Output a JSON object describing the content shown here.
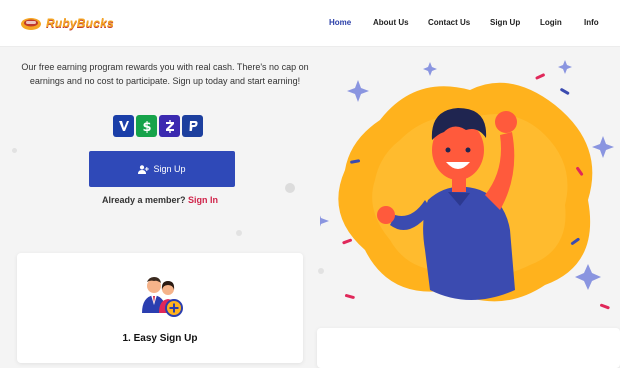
{
  "brand": {
    "name": "RubyBucks"
  },
  "nav": {
    "items": [
      {
        "label": "Home",
        "active": true
      },
      {
        "label": "About Us"
      },
      {
        "label": "Contact Us"
      },
      {
        "label": "Sign Up"
      },
      {
        "label": "Login"
      },
      {
        "label": "Info"
      }
    ]
  },
  "hero": {
    "description": "Our free earning program rewards you with real cash. There's no cap on earnings and no cost to participate. Sign up today and start earning!",
    "payment_icons": [
      "venmo-icon",
      "cashapp-icon",
      "zelle-icon",
      "paypal-icon"
    ],
    "signup_label": "Sign Up",
    "member_prompt": "Already a member?",
    "signin_label": "Sign In"
  },
  "steps": [
    {
      "title": "1. Easy Sign Up"
    }
  ],
  "colors": {
    "primary": "#2f49b8",
    "accent_red": "#d0244a",
    "brand_orange": "#f5a623",
    "blob_orange": "#ffb21d"
  }
}
